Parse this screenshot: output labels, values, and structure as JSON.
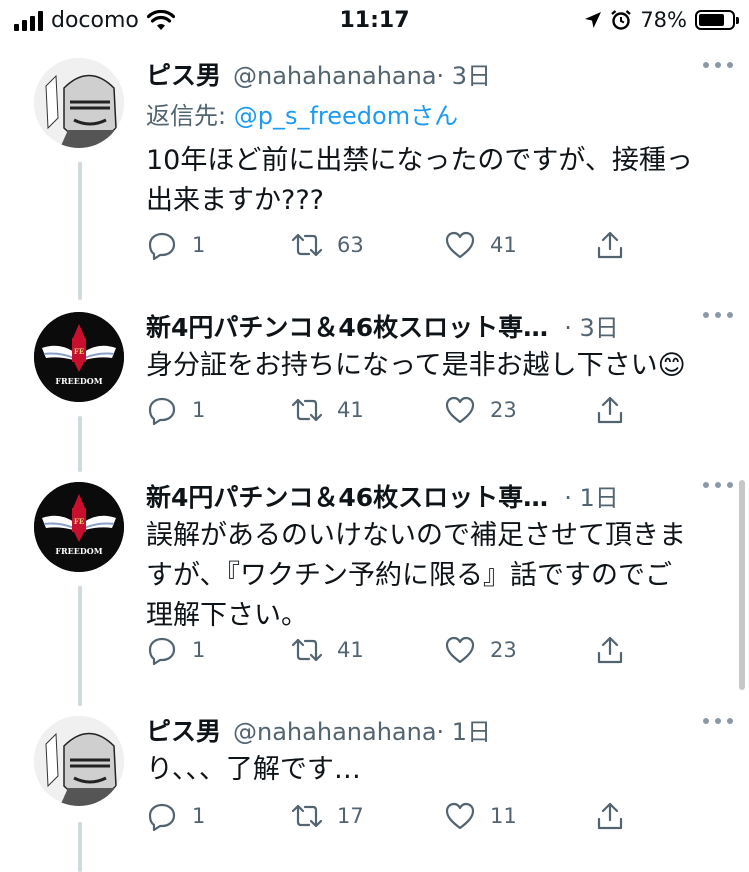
{
  "status_bar": {
    "carrier": "docomo",
    "time": "11:17",
    "battery": "78%",
    "battery_level": 0.78
  },
  "tweets": [
    {
      "name": "ピス男",
      "handle": "@nahahanahana",
      "time": "· 3日",
      "reply_prefix": "返信先: ",
      "reply_to": "@p_s_freedomさん",
      "text_lines": [
        "10年ほど前に出禁になったのですが、接種っ",
        "出来ますか???"
      ],
      "replies": "1",
      "retweets": "63",
      "likes": "41"
    },
    {
      "name": "新4円パチンコ＆46枚スロット専…",
      "time": "· 3日",
      "text_lines": [
        "身分証をお持ちになって是非お越し下さい😊"
      ],
      "replies": "1",
      "retweets": "41",
      "likes": "23",
      "avatar_text": "FREEDOM"
    },
    {
      "name": "新4円パチンコ＆46枚スロット専…",
      "time": "· 1日",
      "text_lines": [
        "誤解があるのいけないので補足させて頂きま",
        "すが、『ワクチン予約に限る』話ですのでご",
        "理解下さい。"
      ],
      "replies": "1",
      "retweets": "41",
      "likes": "23",
      "avatar_text": "FREEDOM"
    },
    {
      "name": "ピス男",
      "handle": "@nahahanahana",
      "time": "· 1日",
      "text_lines": [
        "り、、、了解です…"
      ],
      "replies": "1",
      "retweets": "17",
      "likes": "11"
    }
  ],
  "icons": {
    "reply": "reply-icon",
    "retweet": "retweet-icon",
    "like": "heart-icon",
    "share": "share-icon",
    "more": "more-icon"
  },
  "colors": {
    "link": "#1d9bf0",
    "secondary_text": "#536471",
    "thread_line": "#cfd9de"
  }
}
